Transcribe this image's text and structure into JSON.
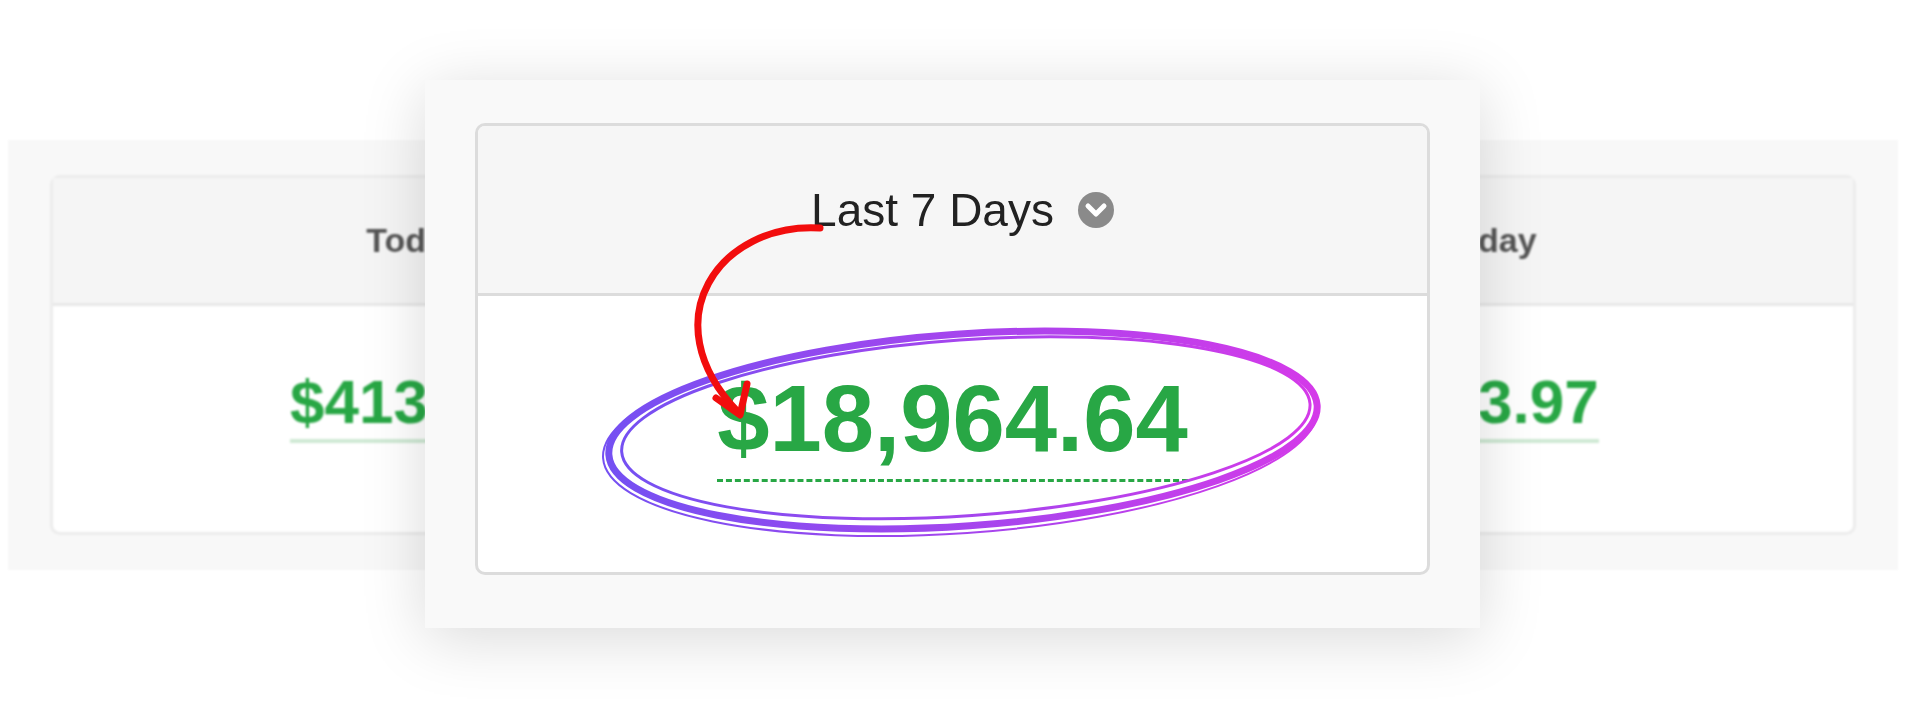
{
  "background_cards": {
    "left": {
      "header": "Tod",
      "value": "$413"
    },
    "right": {
      "header": "day",
      "value": "3.97"
    }
  },
  "stat_card": {
    "period": "Last 7 Days",
    "total": "$18,964.64"
  }
}
